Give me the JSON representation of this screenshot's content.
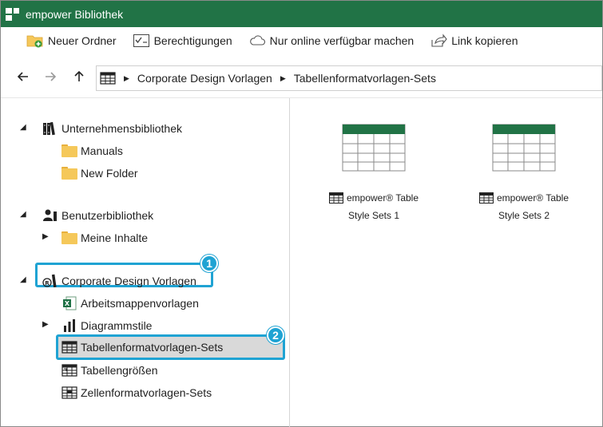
{
  "window": {
    "title": "empower Bibliothek"
  },
  "toolbar": {
    "new_folder": "Neuer Ordner",
    "permissions": "Berechtigungen",
    "online_only": "Nur online verfügbar machen",
    "copy_link": "Link kopieren"
  },
  "breadcrumb": {
    "items": [
      "Corporate Design Vorlagen",
      "Tabellenformatvorlagen-Sets"
    ]
  },
  "tree": {
    "company_library": "Unternehmensbibliothek",
    "manuals": "Manuals",
    "new_folder": "New Folder",
    "user_library": "Benutzerbibliothek",
    "my_content": "Meine Inhalte",
    "corporate_design": "Corporate Design Vorlagen",
    "workbook_templates": "Arbeitsmappenvorlagen",
    "chart_styles": "Diagrammstile",
    "table_format_sets": "Tabellenformatvorlagen-Sets",
    "table_sizes": "Tabellengrößen",
    "cell_format_sets": "Zellenformatvorlagen-Sets"
  },
  "annotations": {
    "badge1": "1",
    "badge2": "2"
  },
  "content": {
    "tiles": [
      {
        "line1": "empower® Table",
        "line2": "Style Sets 1"
      },
      {
        "line1": "empower® Table",
        "line2": "Style Sets 2"
      }
    ]
  },
  "colors": {
    "title_bar": "#217346",
    "highlight": "#1fa3d3",
    "selected_row": "#d9d9d9"
  }
}
